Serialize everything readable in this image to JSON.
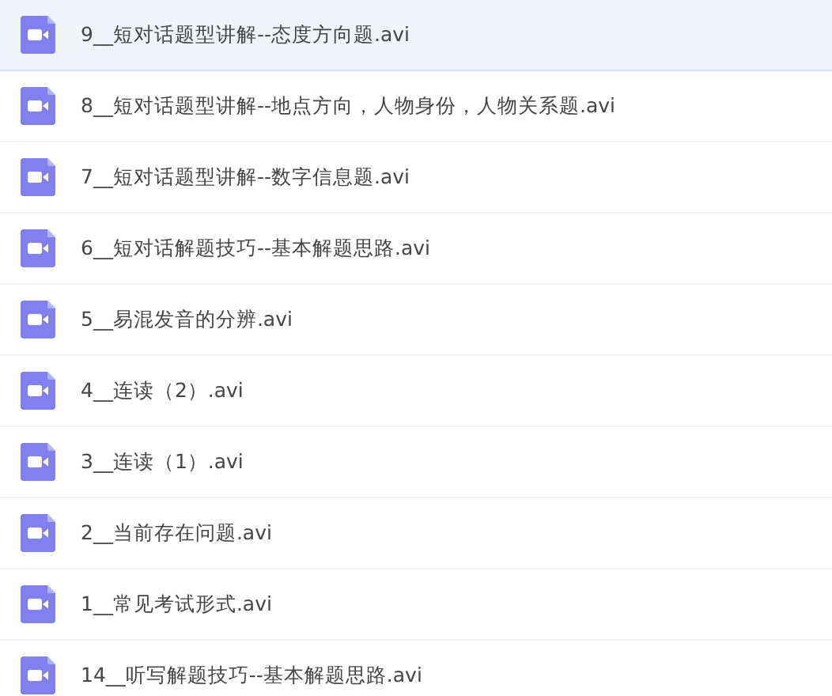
{
  "files": [
    {
      "name": "9__短对话题型讲解--态度方向题.avi",
      "selected": true
    },
    {
      "name": "8__短对话题型讲解--地点方向，人物身份，人物关系题.avi",
      "selected": false
    },
    {
      "name": "7__短对话题型讲解--数字信息题.avi",
      "selected": false
    },
    {
      "name": "6__短对话解题技巧--基本解题思路.avi",
      "selected": false
    },
    {
      "name": "5__易混发音的分辨.avi",
      "selected": false
    },
    {
      "name": "4__连读（2）.avi",
      "selected": false
    },
    {
      "name": "3__连读（1）.avi",
      "selected": false
    },
    {
      "name": "2__当前存在问题.avi",
      "selected": false
    },
    {
      "name": "1__常见考试形式.avi",
      "selected": false
    },
    {
      "name": "14__听写解题技巧--基本解题思路.avi",
      "selected": false
    }
  ]
}
